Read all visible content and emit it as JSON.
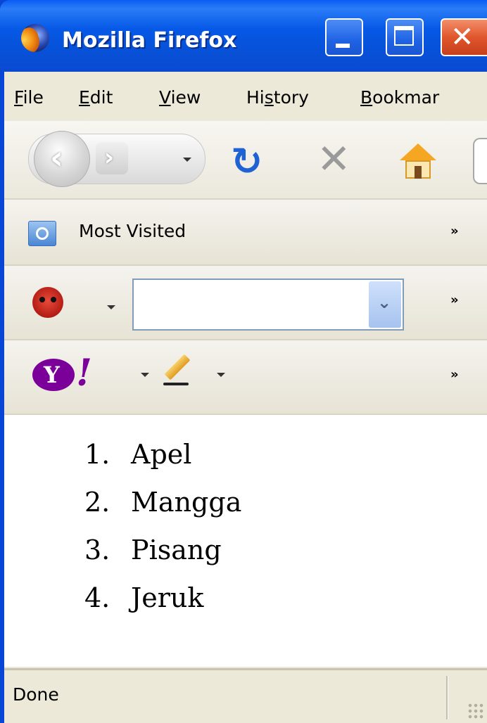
{
  "window": {
    "title": "Mozilla Firefox",
    "icon": "firefox-icon",
    "controls": [
      "minimize-icon",
      "maximize-icon",
      "close-icon"
    ]
  },
  "menubar": {
    "items": [
      {
        "label": "File",
        "underline": "F"
      },
      {
        "label": "Edit",
        "underline": "E"
      },
      {
        "label": "View",
        "underline": "V"
      },
      {
        "label": "History",
        "underline": "s"
      },
      {
        "label": "Bookmar",
        "underline": "B"
      }
    ]
  },
  "navigation": {
    "icons": [
      "back-icon",
      "forward-icon",
      "history-dropdown-icon",
      "reload-icon",
      "stop-icon",
      "home-icon"
    ]
  },
  "bookmarks_toolbar": {
    "item_label": "Most Visited",
    "chevron": "»"
  },
  "search_toolbar": {
    "search_value": "",
    "chevron": "»"
  },
  "yahoo_toolbar": {
    "logo_text": "Y!",
    "chevron": "»"
  },
  "content": {
    "list": [
      {
        "num": "1.",
        "text": "Apel"
      },
      {
        "num": "2.",
        "text": "Mangga"
      },
      {
        "num": "3.",
        "text": "Pisang"
      },
      {
        "num": "4.",
        "text": "Jeruk"
      }
    ]
  },
  "statusbar": {
    "text": "Done"
  },
  "colors": {
    "title_bar": "#0659e6",
    "chrome": "#ece9d8",
    "close_button": "#e0562c",
    "yahoo_purple": "#7b0099"
  }
}
